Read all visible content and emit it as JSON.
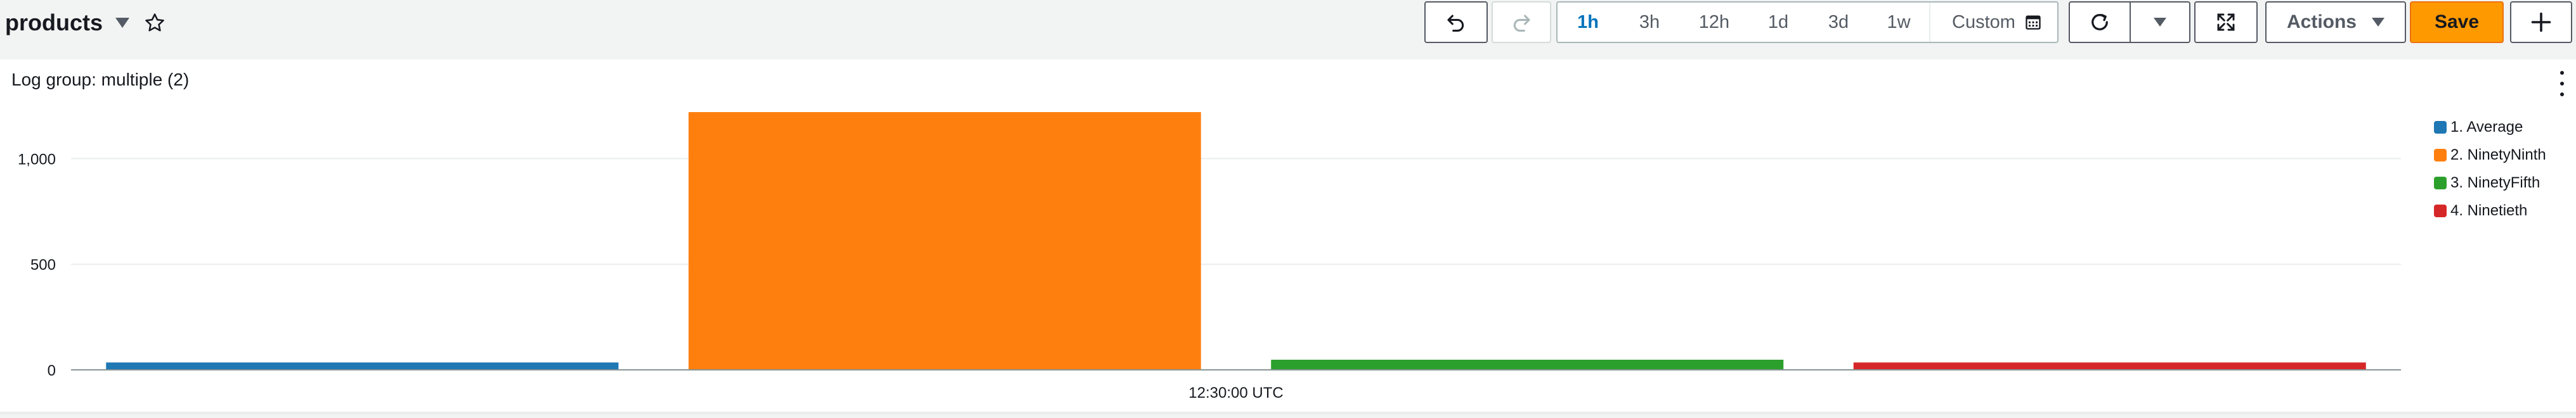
{
  "header": {
    "title": "products"
  },
  "toolbar": {
    "time_ranges": [
      {
        "label": "1h",
        "selected": true
      },
      {
        "label": "3h",
        "selected": false
      },
      {
        "label": "12h",
        "selected": false
      },
      {
        "label": "1d",
        "selected": false
      },
      {
        "label": "3d",
        "selected": false
      },
      {
        "label": "1w",
        "selected": false
      }
    ],
    "custom_label": "Custom",
    "actions_label": "Actions",
    "save_label": "Save",
    "icons": [
      "undo-icon",
      "redo-icon",
      "calendar-icon",
      "refresh-icon",
      "caret-down-icon",
      "fullscreen-icon",
      "plus-icon"
    ]
  },
  "widget": {
    "title": "Log group: multiple (2)"
  },
  "chart_data": {
    "type": "bar",
    "x_label": "12:30:00 UTC",
    "y_ticks": [
      0,
      500,
      1000
    ],
    "y_tick_labels": [
      "0",
      "500",
      "1,000"
    ],
    "ylim": [
      0,
      1220
    ],
    "grid": true,
    "legend_position": "right",
    "series": [
      {
        "name": "1. Average",
        "value": 35,
        "color": "#1f77b4"
      },
      {
        "name": "2. NinetyNinth",
        "value": 1220,
        "color": "#ff7f0e"
      },
      {
        "name": "3. NinetyFifth",
        "value": 48,
        "color": "#2ca02c"
      },
      {
        "name": "4. Ninetieth",
        "value": 35,
        "color": "#d62728"
      }
    ]
  }
}
